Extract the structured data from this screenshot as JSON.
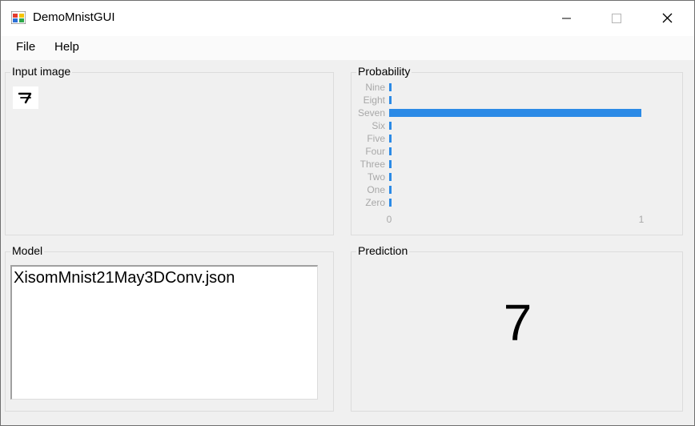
{
  "window": {
    "title": "DemoMnistGUI",
    "minimize_icon": "minimize-icon",
    "maximize_icon": "maximize-icon",
    "close_icon": "close-icon",
    "app_icon": "app-window-icon"
  },
  "menu": {
    "items": [
      "File",
      "Help"
    ]
  },
  "input_image": {
    "title": "Input image",
    "digit_shown": "7"
  },
  "probability": {
    "title": "Probability",
    "bar_color": "#2b8ae6"
  },
  "chart_data": {
    "type": "bar",
    "orientation": "horizontal",
    "categories": [
      "Nine",
      "Eight",
      "Seven",
      "Six",
      "Five",
      "Four",
      "Three",
      "Two",
      "One",
      "Zero"
    ],
    "values": [
      0,
      0,
      1,
      0,
      0,
      0,
      0,
      0,
      0,
      0
    ],
    "xlim": [
      0,
      1
    ],
    "xticks": [
      "0",
      "1"
    ],
    "grid": false
  },
  "model": {
    "title": "Model",
    "value": "XisomMnist21May3DConv.json"
  },
  "prediction": {
    "title": "Prediction",
    "value": "7"
  }
}
